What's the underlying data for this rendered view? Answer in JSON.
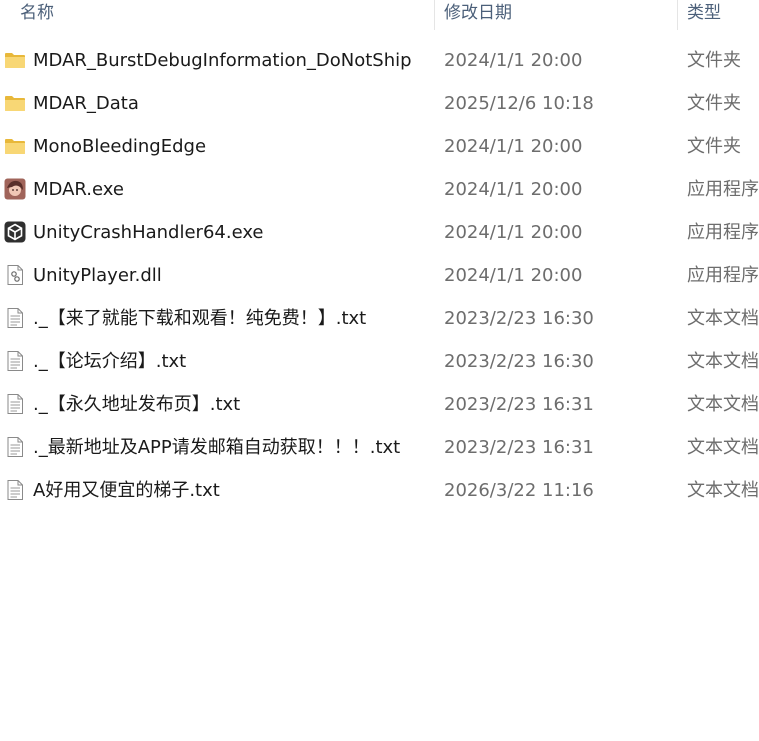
{
  "columns": {
    "name": "名称",
    "date": "修改日期",
    "type": "类型"
  },
  "files": [
    {
      "name": "MDAR_BurstDebugInformation_DoNotShip",
      "date": "2024/1/1 20:00",
      "type": "文件夹",
      "icon": "folder-icon"
    },
    {
      "name": "MDAR_Data",
      "date": "2025/12/6 10:18",
      "type": "文件夹",
      "icon": "folder-icon"
    },
    {
      "name": "MonoBleedingEdge",
      "date": "2024/1/1 20:00",
      "type": "文件夹",
      "icon": "folder-icon"
    },
    {
      "name": "MDAR.exe",
      "date": "2024/1/1 20:00",
      "type": "应用程序",
      "icon": "app-character-icon"
    },
    {
      "name": "UnityCrashHandler64.exe",
      "date": "2024/1/1 20:00",
      "type": "应用程序",
      "icon": "unity-icon"
    },
    {
      "name": "UnityPlayer.dll",
      "date": "2024/1/1 20:00",
      "type": "应用程序",
      "icon": "dll-file-icon"
    },
    {
      "name": "._【来了就能下载和观看！纯免费！】.txt",
      "date": "2023/2/23 16:30",
      "type": "文本文档",
      "icon": "text-file-icon"
    },
    {
      "name": "._【论坛介绍】.txt",
      "date": "2023/2/23 16:30",
      "type": "文本文档",
      "icon": "text-file-icon"
    },
    {
      "name": "._【永久地址发布页】.txt",
      "date": "2023/2/23 16:31",
      "type": "文本文档",
      "icon": "text-file-icon"
    },
    {
      "name": "._最新地址及APP请发邮箱自动获取！！！.txt",
      "date": "2023/2/23 16:31",
      "type": "文本文档",
      "icon": "text-file-icon"
    },
    {
      "name": "A好用又便宜的梯子.txt",
      "date": "2026/3/22 11:16",
      "type": "文本文档",
      "icon": "text-file-icon"
    }
  ],
  "colors": {
    "header_text": "#4c607a",
    "folder": "#f8d775",
    "folder_dark": "#e8b83a",
    "secondary_text": "#6d6d6d"
  }
}
